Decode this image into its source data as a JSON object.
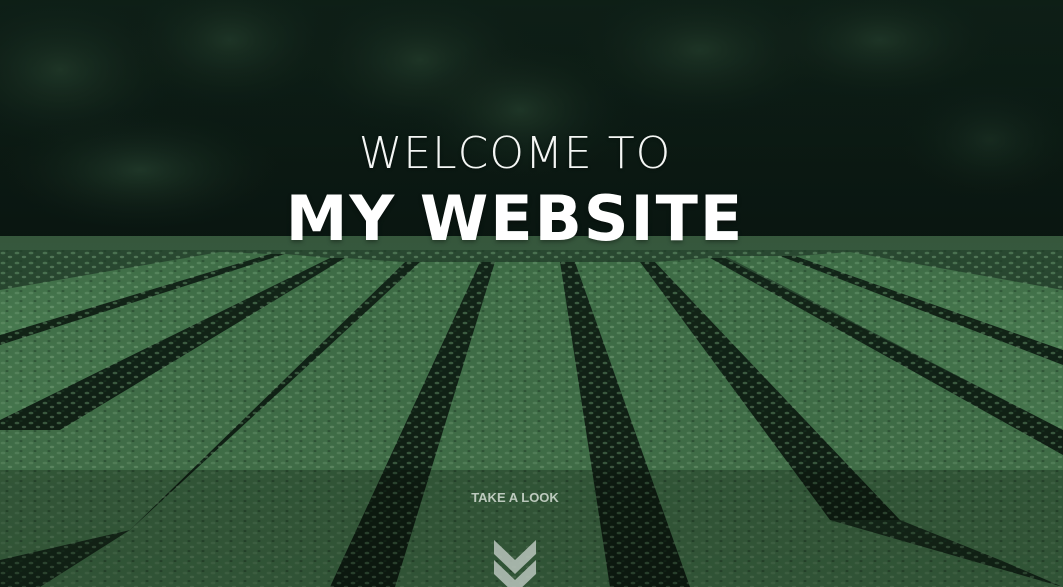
{
  "hero": {
    "title_line1": "WELCOME TO",
    "title_line2": "MY WEBSITE",
    "cta_label": "TAKE A LOOK",
    "scroll_icon": "double-chevron-down-icon",
    "background_image": "tea-plantation-rows"
  },
  "colors": {
    "text": "#ffffff",
    "cta_text": "#c9d2cb",
    "chevron": "#b9c4bc",
    "forest_dark": "#0c1a12",
    "field_green": "#2f5a38"
  }
}
